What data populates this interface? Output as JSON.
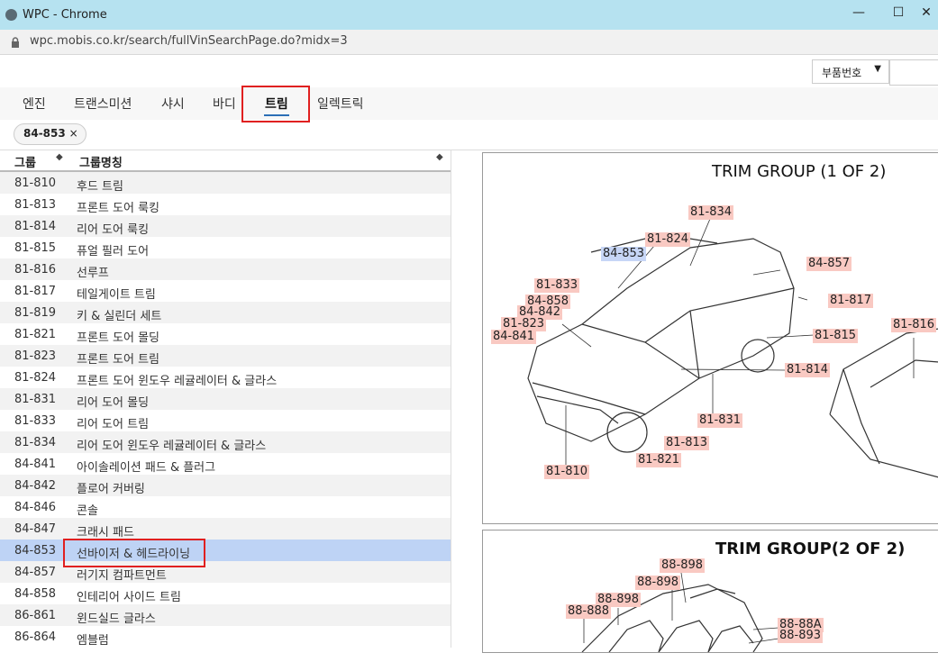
{
  "window": {
    "title": "WPC - Chrome",
    "url": "wpc.mobis.co.kr/search/fullVinSearchPage.do?midx=3"
  },
  "search": {
    "type_value": "부품번호",
    "query": ""
  },
  "tabs": [
    "엔진",
    "트랜스미션",
    "샤시",
    "바디",
    "트림",
    "일렉트릭"
  ],
  "active_tab": "트림",
  "filter_chip": {
    "label": "84-853",
    "remove": "×"
  },
  "list": {
    "headers": {
      "group": "그룹",
      "group_name": "그룹명칭"
    },
    "rows": [
      {
        "code": "81-810",
        "name": "후드 트림"
      },
      {
        "code": "81-813",
        "name": "프론트 도어 룩킹"
      },
      {
        "code": "81-814",
        "name": "리어 도어 룩킹"
      },
      {
        "code": "81-815",
        "name": "퓨얼 필러 도어"
      },
      {
        "code": "81-816",
        "name": "선루프"
      },
      {
        "code": "81-817",
        "name": "테일게이트 트림"
      },
      {
        "code": "81-819",
        "name": "키 & 실린더 세트"
      },
      {
        "code": "81-821",
        "name": "프론트 도어 몰딩"
      },
      {
        "code": "81-823",
        "name": "프론트 도어 트림"
      },
      {
        "code": "81-824",
        "name": "프론트 도어 윈도우 레귤레이터 & 글라스"
      },
      {
        "code": "81-831",
        "name": "리어 도어 몰딩"
      },
      {
        "code": "81-833",
        "name": "리어 도어 트림"
      },
      {
        "code": "81-834",
        "name": "리어 도어 윈도우 레귤레이터 & 글라스"
      },
      {
        "code": "84-841",
        "name": "아이솔레이션 패드 & 플러그"
      },
      {
        "code": "84-842",
        "name": "플로어 커버링"
      },
      {
        "code": "84-846",
        "name": "콘솔"
      },
      {
        "code": "84-847",
        "name": "크래시 패드"
      },
      {
        "code": "84-853",
        "name": "선바이저 & 헤드라이닝"
      },
      {
        "code": "84-857",
        "name": "러기지 컴파트먼트"
      },
      {
        "code": "84-858",
        "name": "인테리어 사이드 트림"
      },
      {
        "code": "86-861",
        "name": "윈드실드 글라스"
      },
      {
        "code": "86-864",
        "name": "엠블럼"
      }
    ],
    "selected_code": "84-853"
  },
  "diagram1": {
    "title": "TRIM GROUP (1 OF 2)",
    "labels": [
      "81-834",
      "81-824",
      "84-853",
      "84-857",
      "81-833",
      "84-858",
      "84-842",
      "81-823",
      "84-841",
      "81-817",
      "81-816",
      "81-815",
      "81-814",
      "81-831",
      "81-813",
      "81-821",
      "81-810"
    ]
  },
  "diagram2": {
    "title": "TRIM GROUP(2 OF 2)",
    "labels": [
      "88-898",
      "88-898",
      "88-898",
      "88-888",
      "88-88A",
      "88-893"
    ]
  }
}
